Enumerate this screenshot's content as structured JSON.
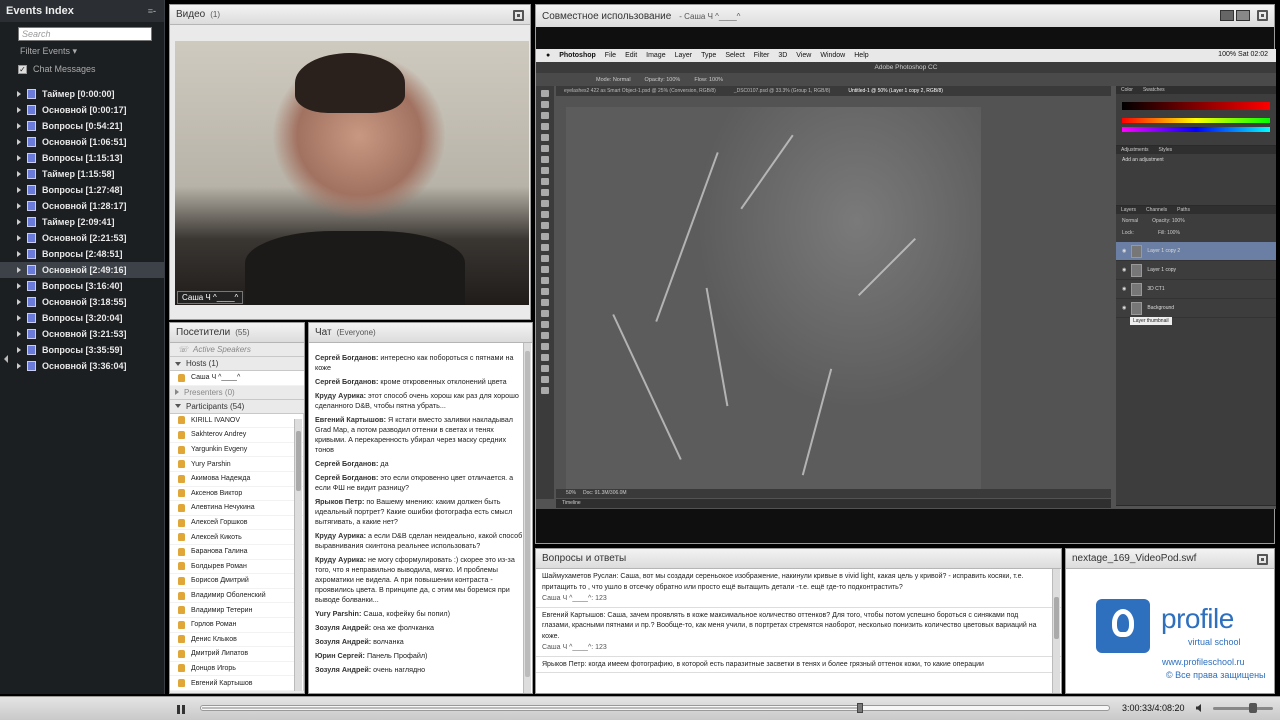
{
  "sidebar": {
    "title": "Events Index",
    "menu_icon": "≡-",
    "search_placeholder": "Search",
    "filter_label": "Filter Events",
    "chat_messages_label": "Chat Messages",
    "events": [
      {
        "label": "Таймер [0:00:00]"
      },
      {
        "label": "Основной [0:00:17]"
      },
      {
        "label": "Вопросы [0:54:21]"
      },
      {
        "label": "Основной [1:06:51]"
      },
      {
        "label": "Вопросы [1:15:13]"
      },
      {
        "label": "Таймер [1:15:58]"
      },
      {
        "label": "Вопросы [1:27:48]"
      },
      {
        "label": "Основной [1:28:17]"
      },
      {
        "label": "Таймер [2:09:41]"
      },
      {
        "label": "Основной [2:21:53]"
      },
      {
        "label": "Вопросы [2:48:51]"
      },
      {
        "label": "Основной [2:49:16]"
      },
      {
        "label": "Вопросы [3:16:40]"
      },
      {
        "label": "Основной [3:18:55]"
      },
      {
        "label": "Вопросы [3:20:04]"
      },
      {
        "label": "Основной [3:21:53]"
      },
      {
        "label": "Вопросы [3:35:59]"
      },
      {
        "label": "Основной [3:36:04]"
      }
    ],
    "selected_index": 11
  },
  "video": {
    "title": "Видео",
    "count": "(1)",
    "name_badge": "Саша Ч ^____^"
  },
  "attendees": {
    "title": "Посетители",
    "count": "(55)",
    "active_speakers": "Active Speakers",
    "hosts_label": "Hosts (1)",
    "host_name": "Саша Ч ^____^",
    "presenters_label": "Presenters (0)",
    "participants_label": "Participants (54)",
    "participants": [
      "KIRILL IVANOV",
      "Sakhterov Andrey",
      "Yargunkin Evgeny",
      "Yury Parshin",
      "Акимова Надежда",
      "Аксенов Виктор",
      "Алевтина Нечукина",
      "Алексей Горшков",
      "Алексей Кикоть",
      "Баранова Галина",
      "Болдырев Роман",
      "Борисов Дмитрий",
      "Владимир Оболенский",
      "Владимир Тетерин",
      "Горлов Роман",
      "Денис Клыков",
      "Дмитрий Липатов",
      "Донцов Игорь",
      "Евгений Картышов"
    ]
  },
  "chat": {
    "title": "Чат",
    "audience": "(Everyone)",
    "messages": [
      {
        "author": "Сергей Богданов:",
        "text": "интересно как побороться с пятнами на коже"
      },
      {
        "author": "Сергей Богданов:",
        "text": "кроме откровенных отклонений цвета"
      },
      {
        "author": "Круду Аурика:",
        "text": "этот способ очень хорош как раз для хорошо сделанного D&B, чтобы пятна убрать..."
      },
      {
        "author": "Евгений Картышов:",
        "text": "Я кстати вместо заливки накладывал Grad Map, а потом разводил оттенки в светах и тенях кривыми. А перекаренность убирал через маску средних тонов"
      },
      {
        "author": "Сергей Богданов:",
        "text": "да"
      },
      {
        "author": "Сергей Богданов:",
        "text": "это если откровенно цвет отличается. а если ФШ не видит разницу?"
      },
      {
        "author": "Ярыков Петр:",
        "text": "по Вашему мнению: каким должен быть идеальный портрет? Какие ошибки фотографа есть смысл вытягивать, а какие нет?"
      },
      {
        "author": "Круду Аурика:",
        "text": "а если D&B сделан неидеально, какой способ выравнивания скинтона реальнее использовать?"
      },
      {
        "author": "Круду Аурика:",
        "text": "не могу сформулировать :) скорее это из-за того, что я неправильно выводила, мягко. И проблемы ахроматики не видела. А при повышении контраста - проявились цвета. В принципе да, с этим мы боремся при выводе болванки..."
      },
      {
        "author": "Yury Parshin:",
        "text": "Саша, кофейку бы попил)"
      },
      {
        "author": "Зозуля Андрей:",
        "text": "она же фолчканка"
      },
      {
        "author": "Зозуля Андрей:",
        "text": "волчанка"
      },
      {
        "author": "Юрин Сергей:",
        "text": "Панель Профайл)"
      },
      {
        "author": "Зозуля Андрей:",
        "text": "очень наглядно"
      }
    ]
  },
  "share": {
    "title": "Совместное использование",
    "presenter": "- Саша Ч ^____^",
    "photoshop": {
      "menu": [
        "Photoshop",
        "File",
        "Edit",
        "Image",
        "Layer",
        "Type",
        "Select",
        "Filter",
        "3D",
        "View",
        "Window",
        "Help"
      ],
      "status_right": "100% Sat 02:02",
      "window_title": "Adobe Photoshop CC",
      "options": [
        "Mode: Normal",
        "Opacity: 100%",
        "Flow: 100%"
      ],
      "doc_tabs": [
        "eyelashes2 422 as Smart Object-1.psd @ 25% (Conversion, RGB/8)",
        "_DSC0107.psd @ 33.3% (Group 1, RGB/8)",
        "Untitled-1 @ 50% (Layer 1 copy 2, RGB/8)"
      ],
      "zoom_status": "50%",
      "doc_status": "Doc: 91.3M/306.0M",
      "timeline_label": "Timeline",
      "panel_tabs_color": [
        "Color",
        "Swatches"
      ],
      "panel_tabs_adj": [
        "Adjustments",
        "Styles"
      ],
      "adj_label": "Add an adjustment",
      "panel_tabs_layers": [
        "Layers",
        "Channels",
        "Paths"
      ],
      "blend": "Normal",
      "opacity": "Opacity: 100%",
      "fill": "Fill: 100%",
      "lock": "Lock:",
      "layers": [
        {
          "name": "Layer 1 copy 2",
          "selected": true
        },
        {
          "name": "Layer 1 copy",
          "selected": false
        },
        {
          "name": "3D CT1",
          "selected": false
        },
        {
          "name": "Background",
          "selected": false
        }
      ],
      "tooltip": "Layer thumbnail"
    }
  },
  "qa": {
    "title": "Вопросы и ответы",
    "items": [
      {
        "q": "Шаймухаметов Руслан: Саша, вот мы создади сереньокое изображение, накинули кривые в vivid light, какая цель у кривой? - исправить косяки, т.е. притащить то , что ушло в отсечку обратно или просто ещё вытащить детали -т.е. ещё где-то подконтрастить?",
        "a": "Саша Ч ^____^: 123"
      },
      {
        "q": "Евгений Картышов: Саша, зачем проявлять в коже максимальное количество оттенков? Для того, чтобы потом успешно бороться с синяками под глазами, красными пятнами и пр.? Вообще-то, как меня учили, в портретах стремятся наоборот, несколько понизить количество цветовых вариаций на коже.",
        "a": "Саша Ч ^____^: 123"
      },
      {
        "q": "Ярыков Петр: когда имеем фотографию, в которой есть паразитные засветки в тенях и более грязный оттенок кожи, то какие операции",
        "a": ""
      }
    ]
  },
  "swf": {
    "title": "nextage_169_VideoPod.swf",
    "logo": "profile",
    "logo_sub": "virtual school",
    "site": "www.profileschool.ru",
    "rights": "© Все права защищены"
  },
  "player": {
    "time": "3:00:33/4:08:20",
    "progress": 0.726,
    "volume": 0.7
  }
}
